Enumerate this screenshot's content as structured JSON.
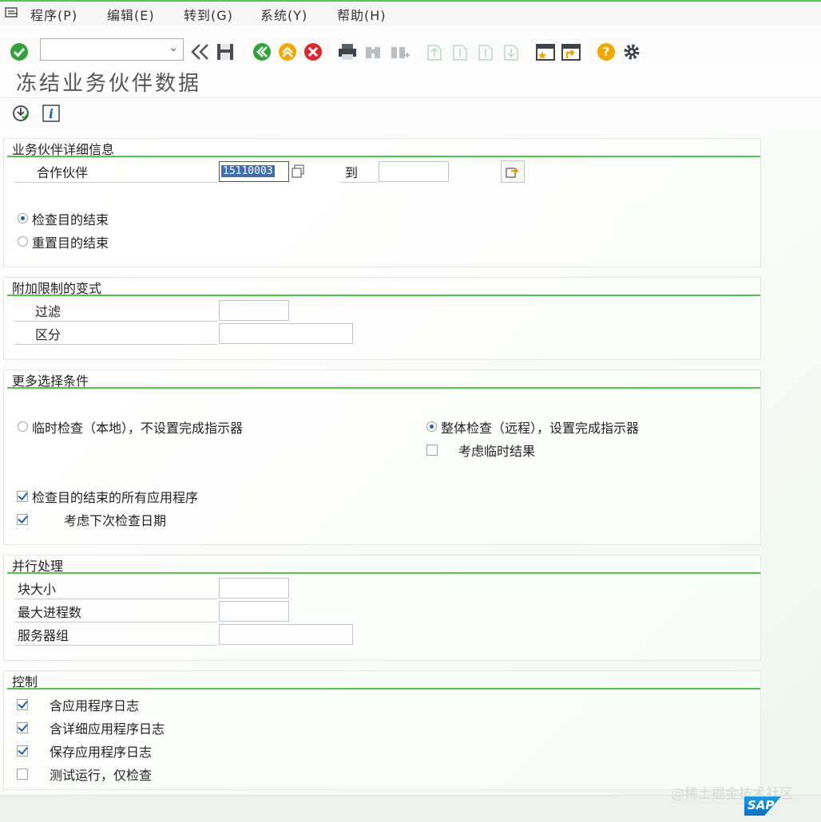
{
  "menu": {
    "items": [
      "程序(P)",
      "编辑(E)",
      "转到(G)",
      "系统(Y)",
      "帮助(H)"
    ]
  },
  "page": {
    "title": "冻结业务伙伴数据"
  },
  "sections": {
    "partner": {
      "title": "业务伙伴详细信息",
      "partner_label": "合作伙伴",
      "partner_value": "15110003",
      "to_label": "到",
      "to_value": "",
      "radio_check_end": "检查目的结束",
      "radio_reset_end": "重置目的结束",
      "radio_selected": "check_end"
    },
    "variant": {
      "title": "附加限制的变式",
      "filter_label": "过滤",
      "filter_value": "",
      "distinct_label": "区分",
      "distinct_value": ""
    },
    "more": {
      "title": "更多选择条件",
      "radio_temp": "临时检查（本地），不设置完成指示器",
      "radio_full": "整体检查（远程），设置完成指示器",
      "radio_selected": "full",
      "consider_temp": "考虑临时结果",
      "consider_temp_checked": false,
      "check_all_apps": "检查目的结束的所有应用程序",
      "check_all_apps_checked": true,
      "consider_next_date": "考虑下次检查日期",
      "consider_next_date_checked": true
    },
    "parallel": {
      "title": "并行处理",
      "block_size_label": "块大小",
      "block_size_value": "",
      "max_proc_label": "最大进程数",
      "max_proc_value": "",
      "server_group_label": "服务器组",
      "server_group_value": ""
    },
    "control": {
      "title": "控制",
      "app_log": "含应用程序日志",
      "app_log_checked": true,
      "detail_log": "含详细应用程序日志",
      "detail_log_checked": true,
      "save_log": "保存应用程序日志",
      "save_log_checked": true,
      "test_run": "测试运行，仅检查",
      "test_run_checked": false
    }
  },
  "watermark": "@稀土掘金技术社区",
  "logo_text": "SAP",
  "colors": {
    "accent_green": "#4fc846",
    "sap_blue": "#0a6fc2"
  }
}
